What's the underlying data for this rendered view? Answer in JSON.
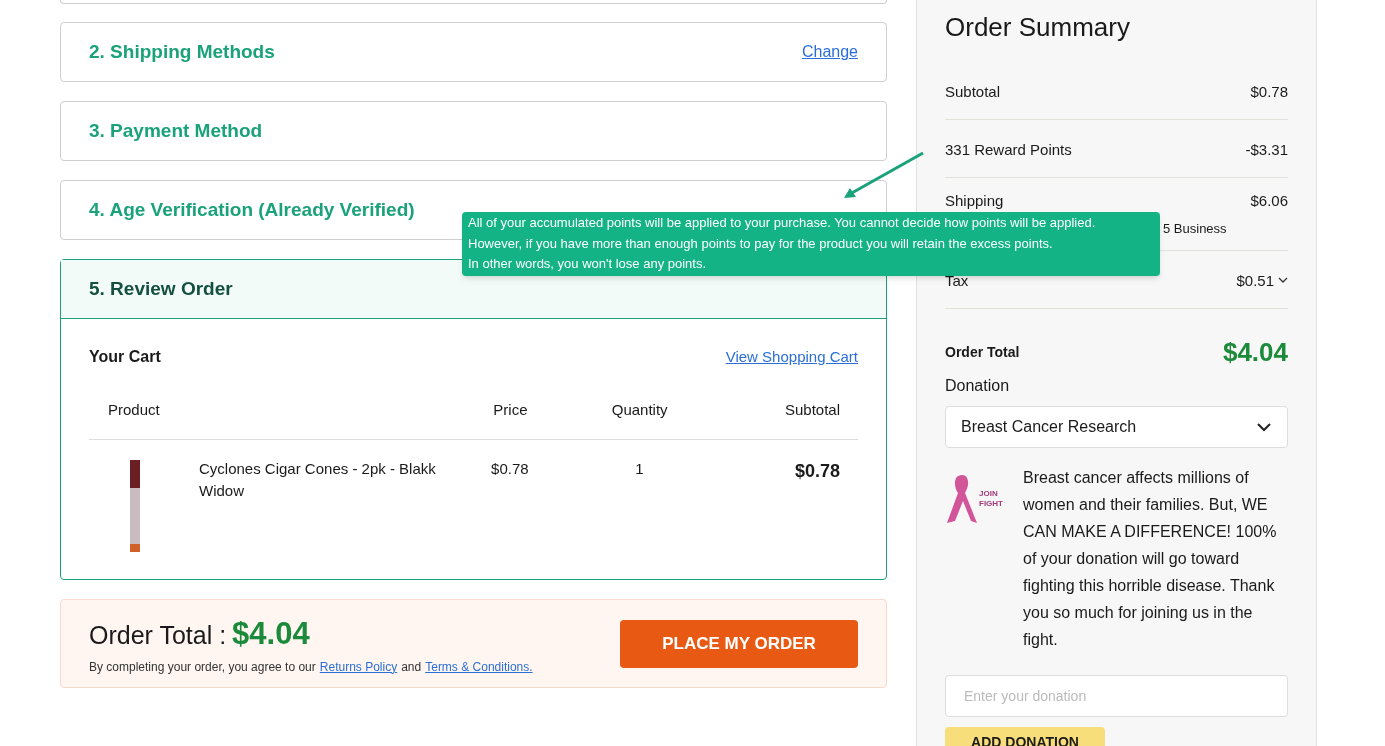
{
  "steps": [
    {
      "title": "2. Shipping Methods",
      "link": "Change"
    },
    {
      "title": "3. Payment Method"
    },
    {
      "title": "4. Age Verification (Already Verified)"
    }
  ],
  "review": {
    "title": "5. Review Order",
    "cart_title": "Your Cart",
    "cart_link": "View Shopping Cart",
    "columns": [
      "Product",
      "Price",
      "Quantity",
      "Subtotal"
    ],
    "rows": [
      {
        "name": "Cyclones Cigar Cones - 2pk - Blakk Widow",
        "price": "$0.78",
        "quantity": "1",
        "subtotal": "$0.78"
      }
    ]
  },
  "footer": {
    "label": "Order Total :",
    "total": "$4.04",
    "note": "By completing your order, you agree to our",
    "link1": "Returns Policy",
    "and": "and",
    "link2": "Terms & Conditions.",
    "button": "PLACE MY ORDER"
  },
  "summary": {
    "title": "Order Summary",
    "lines": [
      {
        "label": "Subtotal",
        "value": "$0.78"
      },
      {
        "label": "331 Reward Points",
        "value": "-$3.31"
      },
      {
        "label": "Shipping",
        "value": "$6.06",
        "detail": "5 Business"
      },
      {
        "label": "Tax",
        "value": "$0.51",
        "expandable": true
      }
    ],
    "total_label": "Order Total",
    "total": "$4.04",
    "donation_label": "Donation",
    "donation_choice": "Breast Cancer Research",
    "donation_text": "Breast cancer affects millions of women and their families. But, WE CAN MAKE A DIFFERENCE! 100% of your donation will go toward fighting this horrible disease. Thank you so much for joining us in the fight.",
    "ribbon_text": [
      "JOIN",
      "FIGHT"
    ],
    "donation_placeholder": "Enter your donation",
    "donation_button": "ADD DONATION"
  },
  "tooltip": [
    "All of your accumulated points will be applied to your purchase. You cannot decide how points will be applied.",
    "However, if you have more than enough points to pay for the product you will retain the excess points.",
    "In other words, you won't lose any points."
  ]
}
